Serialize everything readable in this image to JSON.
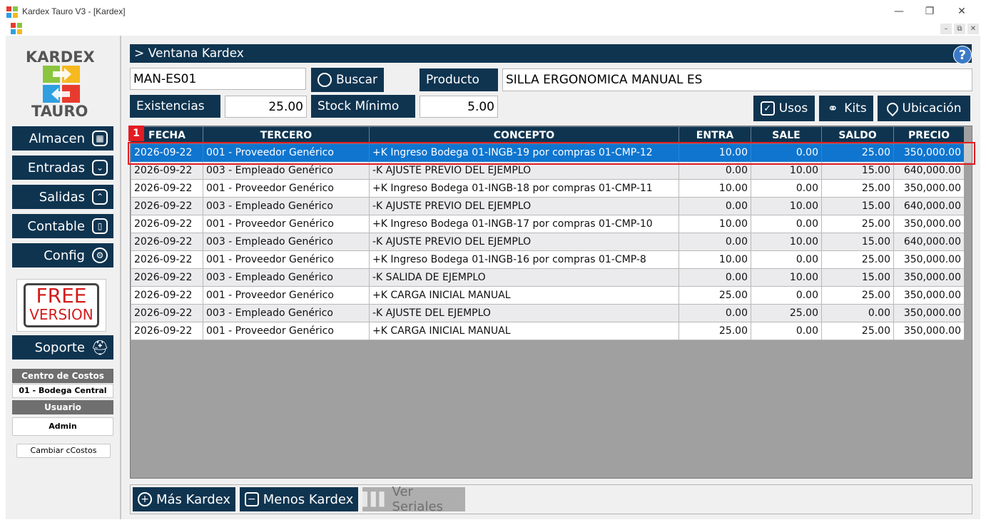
{
  "window": {
    "title": "Kardex Tauro V3 - [Kardex]",
    "minimize": "—",
    "maximize": "❐",
    "close": "✕",
    "mdi_minimize": "–",
    "mdi_restore": "⧉",
    "mdi_close": "✕"
  },
  "sidebar": {
    "logo_top": "KARDEX",
    "logo_bottom": "TAURO",
    "nav": [
      {
        "label": "Almacen",
        "icon": "warehouse-icon"
      },
      {
        "label": "Entradas",
        "icon": "inbox-in-icon"
      },
      {
        "label": "Salidas",
        "icon": "inbox-out-icon"
      },
      {
        "label": "Contable",
        "icon": "book-icon"
      },
      {
        "label": "Config",
        "icon": "gear-icon"
      }
    ],
    "free_line1": "FREE",
    "free_line2": "VERSION",
    "soporte": "Soporte",
    "centro_costos_label": "Centro de Costos",
    "centro_costos_value": "01 - Bodega Central",
    "usuario_label": "Usuario",
    "usuario_value": "Admin",
    "cambiar_btn": "Cambiar cCostos"
  },
  "header": {
    "title": "> Ventana Kardex",
    "help": "?"
  },
  "form": {
    "codigo": "MAN-ES01",
    "buscar": "Buscar",
    "producto_label": "Producto",
    "producto_value": "SILLA ERGONOMICA MANUAL ES",
    "existencias_label": "Existencias",
    "existencias_value": "25.00",
    "stock_min_label": "Stock Mínimo",
    "stock_min_value": "5.00",
    "usos": "Usos",
    "kits": "Kits",
    "ubicacion": "Ubicación"
  },
  "table": {
    "columns": [
      "FECHA",
      "TERCERO",
      "CONCEPTO",
      "ENTRA",
      "SALE",
      "SALDO",
      "PRECIO"
    ],
    "rows": [
      [
        "2026-09-22",
        "001 - Proveedor Genérico",
        "+K Ingreso Bodega 01-INGB-19 por compras 01-CMP-12",
        "10.00",
        "0.00",
        "25.00",
        "350,000.00"
      ],
      [
        "2026-09-22",
        "003 - Empleado Genérico",
        "-K AJUSTE PREVIO DEL EJEMPLO",
        "0.00",
        "10.00",
        "15.00",
        "640,000.00"
      ],
      [
        "2026-09-22",
        "001 - Proveedor Genérico",
        "+K Ingreso Bodega 01-INGB-18 por compras 01-CMP-11",
        "10.00",
        "0.00",
        "25.00",
        "350,000.00"
      ],
      [
        "2026-09-22",
        "003 - Empleado Genérico",
        "-K AJUSTE PREVIO DEL EJEMPLO",
        "0.00",
        "10.00",
        "15.00",
        "640,000.00"
      ],
      [
        "2026-09-22",
        "001 - Proveedor Genérico",
        "+K Ingreso Bodega 01-INGB-17 por compras 01-CMP-10",
        "10.00",
        "0.00",
        "25.00",
        "350,000.00"
      ],
      [
        "2026-09-22",
        "003 - Empleado Genérico",
        "-K AJUSTE PREVIO DEL EJEMPLO",
        "0.00",
        "10.00",
        "15.00",
        "640,000.00"
      ],
      [
        "2026-09-22",
        "001 - Proveedor Genérico",
        "+K Ingreso Bodega 01-INGB-16 por compras 01-CMP-8",
        "10.00",
        "0.00",
        "25.00",
        "350,000.00"
      ],
      [
        "2026-09-22",
        "003 - Empleado Genérico",
        "-K SALIDA DE EJEMPLO",
        "0.00",
        "10.00",
        "15.00",
        "350,000.00"
      ],
      [
        "2026-09-22",
        "001 - Proveedor Genérico",
        "+K CARGA INICIAL MANUAL",
        "25.00",
        "0.00",
        "25.00",
        "350,000.00"
      ],
      [
        "2026-09-22",
        "003 - Empleado Genérico",
        "-K AJUSTE DEL EJEMPLO",
        "0.00",
        "25.00",
        "0.00",
        "350,000.00"
      ],
      [
        "2026-09-22",
        "001 - Proveedor Genérico",
        "+K CARGA INICIAL MANUAL",
        "25.00",
        "0.00",
        "25.00",
        "350,000.00"
      ]
    ],
    "selected_row": 0
  },
  "marker": "1",
  "bottom": {
    "mas": "Más Kardex",
    "menos": "Menos Kardex",
    "seriales": "Ver Seriales"
  },
  "colors": {
    "navy": "#0f3450",
    "selected": "#0f75cf",
    "marker_red": "#e21c22"
  }
}
